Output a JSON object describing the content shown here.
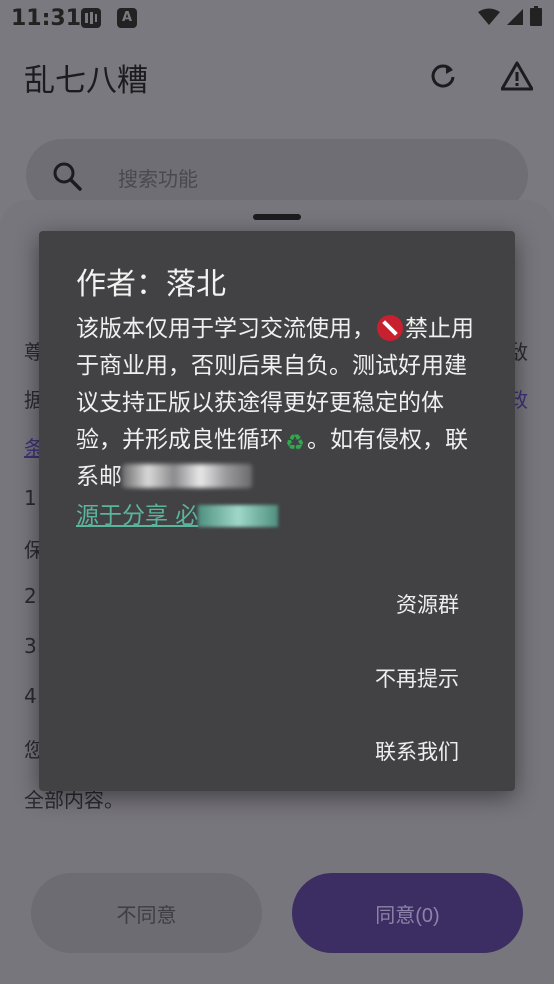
{
  "status_bar": {
    "time": "11:31",
    "app_icon_2": "A"
  },
  "app_bar": {
    "title": "乱七八糟",
    "refresh_icon": "refresh-icon",
    "warning_icon": "warning-icon"
  },
  "search": {
    "placeholder": "搜索功能"
  },
  "background_text": {
    "line1": "尊",
    "line2": "据",
    "line3": "条",
    "line4": "1.",
    "line5": "保",
    "line6": "2.",
    "line7": "3.",
    "line8": "4.",
    "line9": "您",
    "line10": "全部内容。",
    "edge1": "敌",
    "edge2": "政",
    "edge3": "/"
  },
  "bottom_buttons": {
    "disagree": "不同意",
    "agree": "同意(0)"
  },
  "dialog": {
    "title": "作者：落北",
    "body_part1": "该版本仅用于学习交流使用，",
    "body_part2": "禁止用于商业用，否则后果自负。测试好用建议支持正版以获途得更好更稳定的体验，并形成良性循环",
    "body_part3": "。如有侵权，联系邮",
    "link_text": "源于分享 必",
    "actions": [
      "资源群",
      "不再提示",
      "联系我们"
    ]
  },
  "colors": {
    "dialog_bg": "#424244",
    "link": "#5bb49c",
    "agree_button": "#3c2e63"
  }
}
